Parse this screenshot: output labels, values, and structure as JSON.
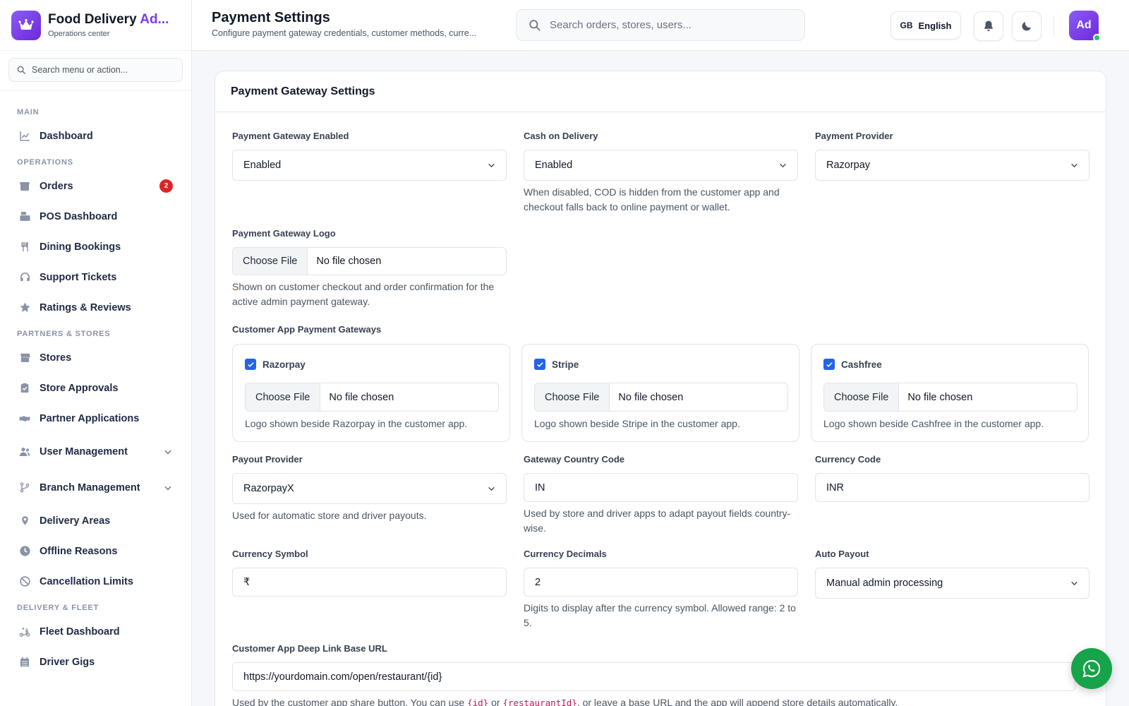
{
  "brand": {
    "title_main": "Food Delivery ",
    "title_accent": "Ad...",
    "subtitle": "Operations center"
  },
  "sidebar": {
    "search_placeholder": "Search menu or action...",
    "sections": {
      "main": "MAIN",
      "operations": "OPERATIONS",
      "partners": "PARTNERS & STORES",
      "delivery": "DELIVERY & FLEET"
    },
    "items": {
      "dashboard": "Dashboard",
      "orders": "Orders",
      "orders_badge": "2",
      "pos": "POS Dashboard",
      "dining": "Dining Bookings",
      "support": "Support Tickets",
      "ratings": "Ratings & Reviews",
      "stores": "Stores",
      "store_approvals": "Store Approvals",
      "partner_apps": "Partner Applications",
      "user_mgmt": "User Management",
      "branch_mgmt": "Branch Management",
      "delivery_areas": "Delivery Areas",
      "offline_reasons": "Offline Reasons",
      "cancel_limits": "Cancellation Limits",
      "fleet_dashboard": "Fleet Dashboard",
      "driver_gigs": "Driver Gigs"
    }
  },
  "header": {
    "title": "Payment Settings",
    "subtitle": "Configure payment gateway credentials, customer methods, curre...",
    "search_placeholder": "Search orders, stores, users...",
    "lang_flag": "GB",
    "lang_label": "English",
    "avatar_initials": "Ad"
  },
  "card": {
    "title": "Payment Gateway Settings",
    "gateway_enabled": {
      "label": "Payment Gateway Enabled",
      "value": "Enabled"
    },
    "cod": {
      "label": "Cash on Delivery",
      "value": "Enabled",
      "help": "When disabled, COD is hidden from the customer app and checkout falls back to online payment or wallet."
    },
    "provider": {
      "label": "Payment Provider",
      "value": "Razorpay"
    },
    "logo": {
      "label": "Payment Gateway Logo",
      "button": "Choose File",
      "file": "No file chosen",
      "help": "Shown on customer checkout and order confirmation for the active admin payment gateway."
    },
    "customer_gateways_label": "Customer App Payment Gateways",
    "gateways": [
      {
        "name": "Razorpay",
        "button": "Choose File",
        "file": "No file chosen",
        "help": "Logo shown beside Razorpay in the customer app."
      },
      {
        "name": "Stripe",
        "button": "Choose File",
        "file": "No file chosen",
        "help": "Logo shown beside Stripe in the customer app."
      },
      {
        "name": "Cashfree",
        "button": "Choose File",
        "file": "No file chosen",
        "help": "Logo shown beside Cashfree in the customer app."
      }
    ],
    "payout_provider": {
      "label": "Payout Provider",
      "value": "RazorpayX",
      "help": "Used for automatic store and driver payouts."
    },
    "country_code": {
      "label": "Gateway Country Code",
      "value": "IN",
      "help": "Used by store and driver apps to adapt payout fields country-wise."
    },
    "currency_code": {
      "label": "Currency Code",
      "value": "INR"
    },
    "currency_symbol": {
      "label": "Currency Symbol",
      "value": "₹"
    },
    "currency_decimals": {
      "label": "Currency Decimals",
      "value": "2",
      "help": "Digits to display after the currency symbol. Allowed range: 2 to 5."
    },
    "auto_payout": {
      "label": "Auto Payout",
      "value": "Manual admin processing"
    },
    "deep_link": {
      "label": "Customer App Deep Link Base URL",
      "value": "https://yourdomain.com/open/restaurant/{id}",
      "help_prefix": "Used by the customer app share button. You can use ",
      "token1": "{id}",
      "help_mid": " or ",
      "token2": "{restaurantId}",
      "help_suffix": ", or leave a base URL and the app will append store details automatically."
    }
  },
  "colors": {
    "accent": "#7c3aed",
    "checkbox": "#2563eb",
    "badge": "#dc2626",
    "whatsapp": "#16a34a"
  }
}
